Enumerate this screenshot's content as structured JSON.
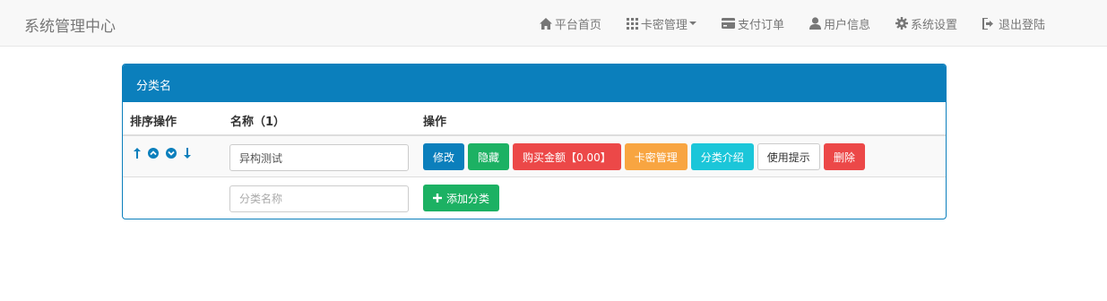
{
  "app": {
    "title": "系统管理中心"
  },
  "nav": {
    "home": "平台首页",
    "cards": "卡密管理",
    "orders": "支付订单",
    "user": "用户信息",
    "settings": "系统设置",
    "logout": "退出登陆"
  },
  "panel": {
    "title": "分类名"
  },
  "table": {
    "headers": {
      "sort": "排序操作",
      "name": "名称（1）",
      "actions": "操作"
    },
    "rows": [
      {
        "name_value": "异构测试",
        "actions": {
          "edit": "修改",
          "hide": "隐藏",
          "price": "购买金额【0.00】",
          "card_manage": "卡密管理",
          "intro": "分类介绍",
          "hint": "使用提示",
          "delete": "删除"
        }
      }
    ],
    "add_row": {
      "placeholder": "分类名称",
      "add_label": "添加分类"
    }
  },
  "colors": {
    "primary": "#0b7fbc",
    "success": "#1cb163",
    "danger": "#ec4848",
    "warning": "#f8a541",
    "info": "#1bc6d9"
  }
}
